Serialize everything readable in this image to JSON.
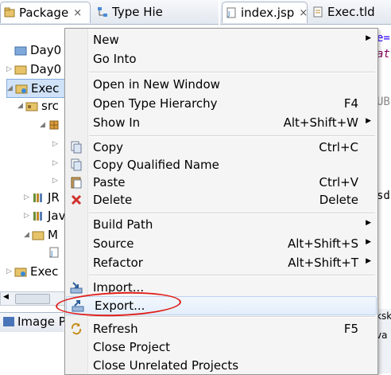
{
  "left_tabs": [
    {
      "label": "Package",
      "close": "×"
    },
    {
      "label": "Type Hie"
    }
  ],
  "right_tabs": [
    {
      "label": "index.jsp",
      "close": "×"
    },
    {
      "label": "Exec.tld"
    }
  ],
  "tree": [
    {
      "label": "Day0"
    },
    {
      "label": "Day0"
    },
    {
      "label": "Exec"
    },
    {
      "label": "src"
    },
    {
      "label": "JR"
    },
    {
      "label": "Jav"
    },
    {
      "label": "M"
    },
    {
      "label": "Exec"
    }
  ],
  "bottom_tab": {
    "label": "Image P"
  },
  "editor_fragments": [
    "e=\"",
    "att",
    "UBL",
    "sdf",
    "ksks",
    "va"
  ],
  "menu": {
    "items": [
      {
        "label": "New",
        "accel": "",
        "submenu": true
      },
      {
        "label": "Go Into",
        "accel": ""
      },
      {
        "label": "Open in New Window",
        "accel": ""
      },
      {
        "label": "Open Type Hierarchy",
        "accel": "F4"
      },
      {
        "label": "Show In",
        "accel": "Alt+Shift+W",
        "submenu": true
      },
      {
        "label": "Copy",
        "accel": "Ctrl+C",
        "icon": "copy-icon"
      },
      {
        "label": "Copy Qualified Name",
        "accel": "",
        "icon": "copy-qualified-icon"
      },
      {
        "label": "Paste",
        "accel": "Ctrl+V",
        "icon": "paste-icon"
      },
      {
        "label": "Delete",
        "accel": "Delete",
        "icon": "delete-icon"
      },
      {
        "label": "Build Path",
        "accel": "",
        "submenu": true
      },
      {
        "label": "Source",
        "accel": "Alt+Shift+S",
        "submenu": true
      },
      {
        "label": "Refactor",
        "accel": "Alt+Shift+T",
        "submenu": true
      },
      {
        "label": "Import...",
        "accel": "",
        "icon": "import-icon"
      },
      {
        "label": "Export...",
        "accel": "",
        "icon": "export-icon"
      },
      {
        "label": "Refresh",
        "accel": "F5",
        "icon": "refresh-icon"
      },
      {
        "label": "Close Project",
        "accel": ""
      },
      {
        "label": "Close Unrelated Projects",
        "accel": ""
      }
    ]
  },
  "colors": {
    "accent": "#84acdd",
    "annotation": "#e0201a",
    "delete": "#d0312d"
  }
}
